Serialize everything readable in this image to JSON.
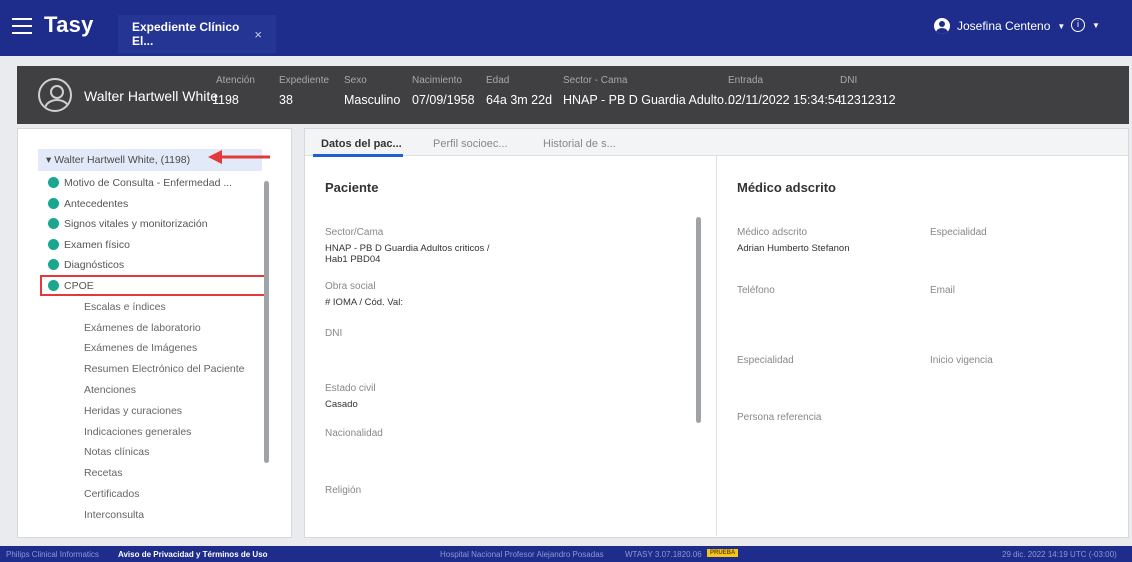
{
  "topbar": {
    "app_name": "Tasy",
    "tab_label": "Expediente Clínico El...",
    "tab_close": "×",
    "user_name": "Josefina Centeno",
    "info_glyph": "i"
  },
  "patient": {
    "name": "Walter Hartwell White",
    "fields": [
      {
        "label": "Atención",
        "value": "1198"
      },
      {
        "label": "Expediente",
        "value": "38"
      },
      {
        "label": "Sexo",
        "value": "Masculino"
      },
      {
        "label": "Nacimiento",
        "value": "07/09/1958"
      },
      {
        "label": "Edad",
        "value": "64a 3m 22d"
      },
      {
        "label": "Sector - Cama",
        "value": "HNAP - PB D Guardia Adulto..."
      },
      {
        "label": "Entrada",
        "value": "02/11/2022 15:34:54"
      },
      {
        "label": "DNI",
        "value": "12312312"
      }
    ]
  },
  "tree": {
    "root": "▾ Walter Hartwell White, (1198)",
    "dot_items": [
      "Motivo de Consulta - Enfermedad ...",
      "Antecedentes",
      "Signos vitales y monitorización",
      "Examen físico",
      "Diagnósticos",
      "CPOE"
    ],
    "plain_items": [
      "Escalas e índices",
      "Exámenes de laboratorio",
      "Exámenes de Imágenes",
      "Resumen Electrónico del Paciente",
      "Atenciones",
      "Heridas y curaciones",
      "Indicaciones generales",
      "Notas clínicas",
      "Recetas",
      "Certificados",
      "Interconsulta"
    ]
  },
  "tabs": [
    "Datos del pac...",
    "Perfil socioec...",
    "Historial de s..."
  ],
  "paciente": {
    "title": "Paciente",
    "sector_label": "Sector/Cama",
    "sector_value_1": "HNAP - PB D Guardia Adultos criticos /",
    "sector_value_2": "Hab1 PBD04",
    "obra_label": "Obra social",
    "obra_value": "# IOMA / Cód. Val:",
    "dni_label": "DNI",
    "estado_label": "Estado civil",
    "estado_value": "Casado",
    "nacionalidad_label": "Nacionalidad",
    "religion_label": "Religión"
  },
  "medico": {
    "title": "Médico adscrito",
    "medico_label": "Médico adscrito",
    "medico_value": "Adrian Humberto Stefanon",
    "especialidad_label": "Especialidad",
    "telefono_label": "Teléfono",
    "email_label": "Email",
    "especialidad2_label": "Especialidad",
    "inicio_label": "Inicio vigencia",
    "persona_label": "Persona referencia"
  },
  "footer": {
    "company": "Philips Clinical Informatics",
    "privacy": "Aviso de Privacidad y Términos de Uso",
    "hospital": "Hospital Nacional Profesor Alejandro Posadas",
    "version": "WTASY 3.07.1820.06",
    "env_badge": "PRUEBA",
    "datetime": "29 dic. 2022  14:19  UTC (-03:00)"
  },
  "colors": {
    "topbar": "#1e2d8c",
    "patient_bar": "#404043",
    "status_dot": "#1aa68f",
    "highlight_red": "#e23a3a",
    "active_tab": "#1e5fd6"
  }
}
